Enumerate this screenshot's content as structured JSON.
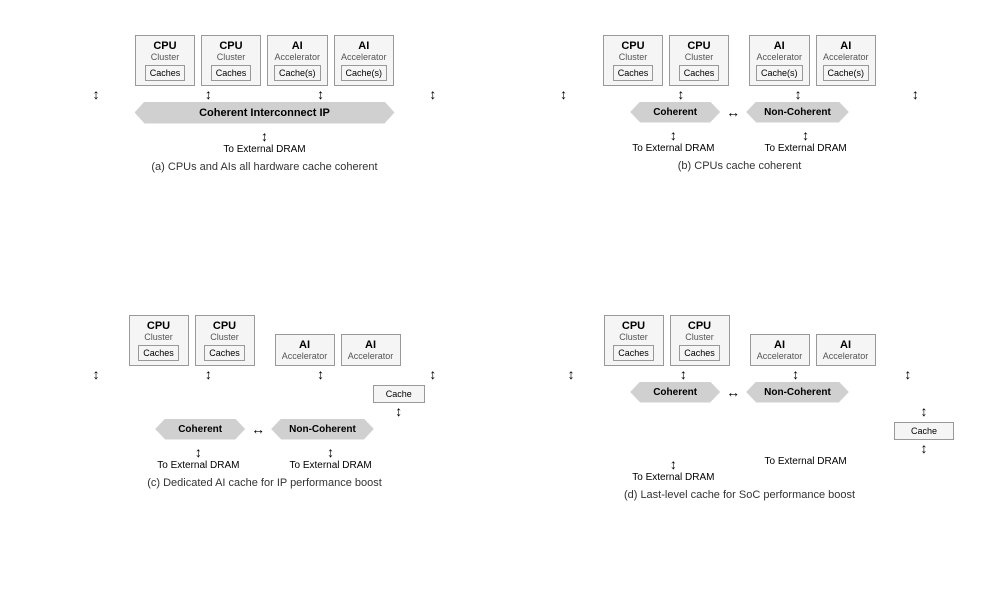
{
  "diagrams": [
    {
      "id": "a",
      "caption": "(a) CPUs and AIs all hardware cache coherent",
      "components": [
        {
          "title": "CPU",
          "subtitle": "Cluster",
          "cache": "Caches"
        },
        {
          "title": "CPU",
          "subtitle": "Cluster",
          "cache": "Caches"
        },
        {
          "title": "AI",
          "subtitle": "Accelerator",
          "cache": "Cache(s)"
        },
        {
          "title": "AI",
          "subtitle": "Accelerator",
          "cache": "Cache(s)"
        }
      ],
      "interconnect": "Coherent Interconnect IP",
      "type": "single_banner",
      "dram": [
        "To External DRAM"
      ]
    },
    {
      "id": "b",
      "caption": "(b) CPUs cache coherent",
      "components_left": [
        {
          "title": "CPU",
          "subtitle": "Cluster",
          "cache": "Caches"
        },
        {
          "title": "CPU",
          "subtitle": "Cluster",
          "cache": "Caches"
        }
      ],
      "components_right": [
        {
          "title": "AI",
          "subtitle": "Accelerator",
          "cache": "Cache(s)"
        },
        {
          "title": "AI",
          "subtitle": "Accelerator",
          "cache": "Cache(s)"
        }
      ],
      "banner_left": "Coherent",
      "banner_right": "Non-Coherent",
      "type": "dual_banner",
      "dram_left": "To External DRAM",
      "dram_right": "To External DRAM"
    },
    {
      "id": "c",
      "caption": "(c) Dedicated AI cache for IP performance boost",
      "components_left": [
        {
          "title": "CPU",
          "subtitle": "Cluster",
          "cache": "Caches"
        },
        {
          "title": "CPU",
          "subtitle": "Cluster",
          "cache": "Caches"
        }
      ],
      "components_right": [
        {
          "title": "AI",
          "subtitle": "Accelerator",
          "cache": null
        },
        {
          "title": "AI",
          "subtitle": "Accelerator",
          "cache": null
        }
      ],
      "cache_box_right": "Cache",
      "banner_left": "Coherent",
      "banner_right": "Non-Coherent",
      "type": "dual_banner_cache",
      "dram_left": "To External DRAM",
      "dram_right": "To External DRAM"
    },
    {
      "id": "d",
      "caption": "(d) Last-level cache for SoC performance boost",
      "components_left": [
        {
          "title": "CPU",
          "subtitle": "Cluster",
          "cache": "Caches"
        },
        {
          "title": "CPU",
          "subtitle": "Cluster",
          "cache": "Caches"
        }
      ],
      "components_right": [
        {
          "title": "AI",
          "subtitle": "Accelerator",
          "cache": null
        },
        {
          "title": "AI",
          "subtitle": "Accelerator",
          "cache": null
        }
      ],
      "banner_left": "Coherent",
      "banner_right": "Non-Coherent",
      "cache_box_below": "Cache",
      "type": "dual_banner_cache_below",
      "dram_left": "To External DRAM",
      "dram_right": "To External DRAM"
    }
  ]
}
